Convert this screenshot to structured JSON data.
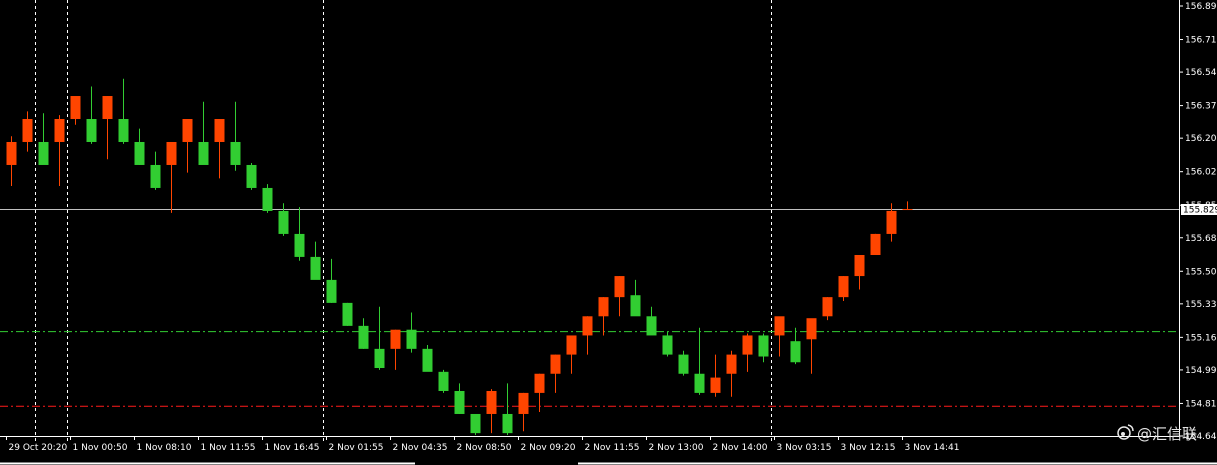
{
  "colors": {
    "background": "#000000",
    "bull": "#ff4500",
    "bear": "#32cd32",
    "grid": "#ffffff",
    "axis": "#ffffff",
    "current_price_line": "#c0c0c0",
    "buy_line": "#32cd32",
    "sell_line": "#ff1a1a"
  },
  "watermark": {
    "icon": "weibo-icon",
    "text": "@汇信联"
  },
  "chart_data": {
    "type": "candlestick",
    "title": "",
    "ylim": [
      154.645,
      156.89
    ],
    "y_ticks": [
      "156.890",
      "156.715",
      "156.545",
      "156.370",
      "156.200",
      "156.025",
      "155.850",
      "155.680",
      "155.505",
      "155.335",
      "155.160",
      "154.990",
      "154.815",
      "154.645"
    ],
    "y_tick_values": [
      156.89,
      156.715,
      156.545,
      156.37,
      156.2,
      156.025,
      155.85,
      155.68,
      155.505,
      155.335,
      155.16,
      154.99,
      154.815,
      154.645
    ],
    "x_ticks": [
      {
        "label": "29 Oct 20:20",
        "bar": 0
      },
      {
        "label": "1 Nov 00:50",
        "bar": 4
      },
      {
        "label": "1 Nov 08:10",
        "bar": 8
      },
      {
        "label": "1 Nov 11:55",
        "bar": 12
      },
      {
        "label": "1 Nov 16:45",
        "bar": 16
      },
      {
        "label": "2 Nov 01:55",
        "bar": 20
      },
      {
        "label": "2 Nov 04:35",
        "bar": 24
      },
      {
        "label": "2 Nov 08:50",
        "bar": 28
      },
      {
        "label": "2 Nov 09:20",
        "bar": 32
      },
      {
        "label": "2 Nov 11:55",
        "bar": 36
      },
      {
        "label": "2 Nov 13:00",
        "bar": 40
      },
      {
        "label": "2 Nov 14:00",
        "bar": 44
      },
      {
        "label": "3 Nov 03:15",
        "bar": 48
      },
      {
        "label": "3 Nov 12:15",
        "bar": 52
      },
      {
        "label": "3 Nov 14:41",
        "bar": 56
      }
    ],
    "session_separators_after_bar": [
      1,
      3,
      19,
      47
    ],
    "current_price": 155.83,
    "current_price_label": "155.829",
    "buy_level": 155.19,
    "sell_level": 154.8,
    "candles": [
      {
        "o": 156.06,
        "h": 156.21,
        "l": 155.95,
        "c": 156.18
      },
      {
        "o": 156.18,
        "h": 156.34,
        "l": 156.13,
        "c": 156.3
      },
      {
        "o": 156.18,
        "h": 156.33,
        "l": 156.14,
        "c": 156.06
      },
      {
        "o": 156.18,
        "h": 156.32,
        "l": 155.95,
        "c": 156.3
      },
      {
        "o": 156.3,
        "h": 156.41,
        "l": 156.27,
        "c": 156.42
      },
      {
        "o": 156.3,
        "h": 156.47,
        "l": 156.17,
        "c": 156.18
      },
      {
        "o": 156.3,
        "h": 156.42,
        "l": 156.09,
        "c": 156.42
      },
      {
        "o": 156.3,
        "h": 156.51,
        "l": 156.17,
        "c": 156.18
      },
      {
        "o": 156.18,
        "h": 156.25,
        "l": 156.06,
        "c": 156.06
      },
      {
        "o": 156.06,
        "h": 156.13,
        "l": 155.93,
        "c": 155.94
      },
      {
        "o": 156.06,
        "h": 156.1,
        "l": 155.81,
        "c": 156.18
      },
      {
        "o": 156.18,
        "h": 156.3,
        "l": 156.02,
        "c": 156.3
      },
      {
        "o": 156.18,
        "h": 156.39,
        "l": 156.1,
        "c": 156.06
      },
      {
        "o": 156.18,
        "h": 156.29,
        "l": 155.99,
        "c": 156.3
      },
      {
        "o": 156.18,
        "h": 156.39,
        "l": 156.03,
        "c": 156.06
      },
      {
        "o": 156.06,
        "h": 156.07,
        "l": 155.93,
        "c": 155.94
      },
      {
        "o": 155.94,
        "h": 155.96,
        "l": 155.81,
        "c": 155.82
      },
      {
        "o": 155.82,
        "h": 155.86,
        "l": 155.69,
        "c": 155.7
      },
      {
        "o": 155.7,
        "h": 155.84,
        "l": 155.56,
        "c": 155.58
      },
      {
        "o": 155.58,
        "h": 155.66,
        "l": 155.55,
        "c": 155.46
      },
      {
        "o": 155.46,
        "h": 155.57,
        "l": 155.34,
        "c": 155.34
      },
      {
        "o": 155.34,
        "h": 155.34,
        "l": 155.22,
        "c": 155.22
      },
      {
        "o": 155.22,
        "h": 155.26,
        "l": 155.1,
        "c": 155.1
      },
      {
        "o": 155.1,
        "h": 155.32,
        "l": 154.99,
        "c": 155.0
      },
      {
        "o": 155.1,
        "h": 155.2,
        "l": 154.99,
        "c": 155.2
      },
      {
        "o": 155.2,
        "h": 155.29,
        "l": 155.08,
        "c": 155.1
      },
      {
        "o": 155.1,
        "h": 155.12,
        "l": 154.99,
        "c": 154.98
      },
      {
        "o": 154.98,
        "h": 154.99,
        "l": 154.87,
        "c": 154.88
      },
      {
        "o": 154.88,
        "h": 154.92,
        "l": 154.76,
        "c": 154.76
      },
      {
        "o": 154.76,
        "h": 154.75,
        "l": 154.65,
        "c": 154.66
      },
      {
        "o": 154.76,
        "h": 154.89,
        "l": 154.66,
        "c": 154.88
      },
      {
        "o": 154.76,
        "h": 154.92,
        "l": 154.65,
        "c": 154.66
      },
      {
        "o": 154.76,
        "h": 154.87,
        "l": 154.67,
        "c": 154.87
      },
      {
        "o": 154.87,
        "h": 154.97,
        "l": 154.77,
        "c": 154.97
      },
      {
        "o": 154.97,
        "h": 155.07,
        "l": 154.87,
        "c": 155.07
      },
      {
        "o": 155.07,
        "h": 155.17,
        "l": 154.97,
        "c": 155.17
      },
      {
        "o": 155.17,
        "h": 155.27,
        "l": 155.07,
        "c": 155.27
      },
      {
        "o": 155.27,
        "h": 155.37,
        "l": 155.17,
        "c": 155.37
      },
      {
        "o": 155.37,
        "h": 155.48,
        "l": 155.27,
        "c": 155.48
      },
      {
        "o": 155.38,
        "h": 155.46,
        "l": 155.29,
        "c": 155.27
      },
      {
        "o": 155.27,
        "h": 155.32,
        "l": 155.18,
        "c": 155.17
      },
      {
        "o": 155.17,
        "h": 155.19,
        "l": 155.06,
        "c": 155.07
      },
      {
        "o": 155.07,
        "h": 155.09,
        "l": 154.96,
        "c": 154.97
      },
      {
        "o": 154.97,
        "h": 155.21,
        "l": 154.86,
        "c": 154.87
      },
      {
        "o": 154.87,
        "h": 155.07,
        "l": 154.85,
        "c": 154.95
      },
      {
        "o": 154.97,
        "h": 155.09,
        "l": 154.85,
        "c": 155.07
      },
      {
        "o": 155.07,
        "h": 155.18,
        "l": 154.98,
        "c": 155.17
      },
      {
        "o": 155.17,
        "h": 155.18,
        "l": 155.03,
        "c": 155.06
      },
      {
        "o": 155.17,
        "h": 155.23,
        "l": 155.06,
        "c": 155.27
      },
      {
        "o": 155.14,
        "h": 155.21,
        "l": 155.02,
        "c": 155.03
      },
      {
        "o": 155.15,
        "h": 155.24,
        "l": 154.97,
        "c": 155.26
      },
      {
        "o": 155.27,
        "h": 155.37,
        "l": 155.25,
        "c": 155.37
      },
      {
        "o": 155.37,
        "h": 155.48,
        "l": 155.35,
        "c": 155.48
      },
      {
        "o": 155.48,
        "h": 155.59,
        "l": 155.41,
        "c": 155.59
      },
      {
        "o": 155.59,
        "h": 155.7,
        "l": 155.59,
        "c": 155.7
      },
      {
        "o": 155.7,
        "h": 155.86,
        "l": 155.66,
        "c": 155.82
      },
      {
        "o": 155.83,
        "h": 155.87,
        "l": 155.83,
        "c": 155.83
      }
    ]
  }
}
